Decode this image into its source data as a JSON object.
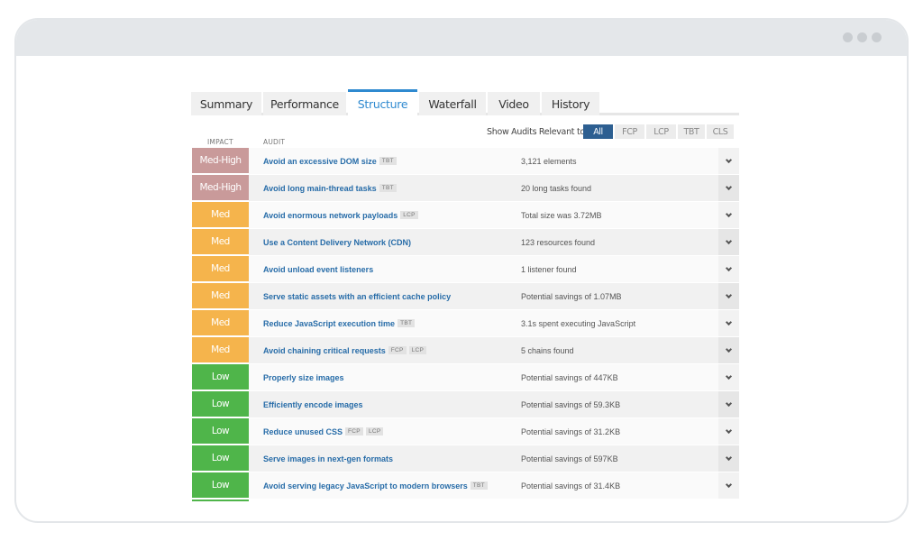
{
  "window": {
    "controls": [
      "dot",
      "dot",
      "dot"
    ]
  },
  "tabs": [
    {
      "label": "Summary",
      "active": false
    },
    {
      "label": "Performance",
      "active": false
    },
    {
      "label": "Structure",
      "active": true
    },
    {
      "label": "Waterfall",
      "active": false
    },
    {
      "label": "Video",
      "active": false
    },
    {
      "label": "History",
      "active": false
    }
  ],
  "columns": {
    "impact": "IMPACT",
    "audit": "AUDIT"
  },
  "filter": {
    "label": "Show Audits Relevant to",
    "options": [
      {
        "label": "All",
        "active": true
      },
      {
        "label": "FCP",
        "active": false
      },
      {
        "label": "LCP",
        "active": false
      },
      {
        "label": "TBT",
        "active": false
      },
      {
        "label": "CLS",
        "active": false
      }
    ]
  },
  "colors": {
    "med_high": "#c99a9a",
    "med": "#f5b44c",
    "low": "#4fb54a",
    "link": "#276ca8",
    "active_tab": "#2f8ad0",
    "active_filter": "#2d5f91"
  },
  "audits": [
    {
      "impact": "Med-High",
      "level": "medhigh",
      "title": "Avoid an excessive DOM size",
      "tags": [
        "TBT"
      ],
      "result": "3,121 elements"
    },
    {
      "impact": "Med-High",
      "level": "medhigh",
      "title": "Avoid long main-thread tasks",
      "tags": [
        "TBT"
      ],
      "result": "20 long tasks found"
    },
    {
      "impact": "Med",
      "level": "med",
      "title": "Avoid enormous network payloads",
      "tags": [
        "LCP"
      ],
      "result": "Total size was 3.72MB"
    },
    {
      "impact": "Med",
      "level": "med",
      "title": "Use a Content Delivery Network (CDN)",
      "tags": [],
      "result": "123 resources found"
    },
    {
      "impact": "Med",
      "level": "med",
      "title": "Avoid unload event listeners",
      "tags": [],
      "result": "1 listener found"
    },
    {
      "impact": "Med",
      "level": "med",
      "title": "Serve static assets with an efficient cache policy",
      "tags": [],
      "result": "Potential savings of 1.07MB"
    },
    {
      "impact": "Med",
      "level": "med",
      "title": "Reduce JavaScript execution time",
      "tags": [
        "TBT"
      ],
      "result": "3.1s spent executing JavaScript"
    },
    {
      "impact": "Med",
      "level": "med",
      "title": "Avoid chaining critical requests",
      "tags": [
        "FCP",
        "LCP"
      ],
      "result": "5 chains found"
    },
    {
      "impact": "Low",
      "level": "low",
      "title": "Properly size images",
      "tags": [],
      "result": "Potential savings of 447KB"
    },
    {
      "impact": "Low",
      "level": "low",
      "title": "Efficiently encode images",
      "tags": [],
      "result": "Potential savings of 59.3KB"
    },
    {
      "impact": "Low",
      "level": "low",
      "title": "Reduce unused CSS",
      "tags": [
        "FCP",
        "LCP"
      ],
      "result": "Potential savings of 31.2KB"
    },
    {
      "impact": "Low",
      "level": "low",
      "title": "Serve images in next-gen formats",
      "tags": [],
      "result": "Potential savings of 597KB"
    },
    {
      "impact": "Low",
      "level": "low",
      "title": "Avoid serving legacy JavaScript to modern browsers",
      "tags": [
        "TBT"
      ],
      "result": "Potential savings of 31.4KB"
    }
  ]
}
